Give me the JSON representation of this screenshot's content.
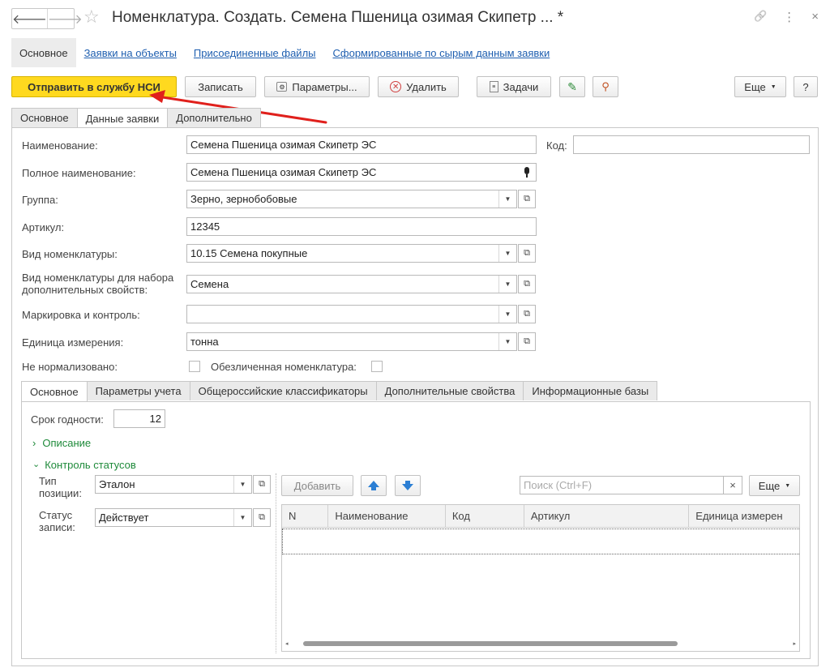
{
  "window": {
    "title": "Номенклатура. Создать. Семена Пшеница озимая Скипетр ... *",
    "back_glyph": "🡐",
    "forward_glyph": "🡒",
    "star_glyph": "☆",
    "link_glyph": "🔗",
    "more_glyph": "⋮",
    "close_glyph": "×"
  },
  "links": {
    "main": "Основное",
    "requests": "Заявки на объекты",
    "files": "Присоединенные файлы",
    "generated": "Сформированные по сырым данным заявки"
  },
  "toolbar": {
    "send": "Отправить в службу НСИ",
    "save": "Записать",
    "params": "Параметры...",
    "delete": "Удалить",
    "tasks": "Задачи",
    "more": "Еще",
    "help": "?"
  },
  "tabs": [
    "Основное",
    "Данные заявки",
    "Дополнительно"
  ],
  "form": {
    "name_label": "Наименование:",
    "name_value": "Семена Пшеница озимая Скипетр ЭС",
    "code_label": "Код:",
    "code_value": "",
    "fullname_label": "Полное наименование:",
    "fullname_value": "Семена Пшеница озимая Скипетр ЭС",
    "group_label": "Группа:",
    "group_value": "Зерно, зернобобовые",
    "article_label": "Артикул:",
    "article_value": "12345",
    "kind_label": "Вид номенклатуры:",
    "kind_value": "10.15 Семена покупные",
    "kind_props_label_1": "Вид номенклатуры для набора",
    "kind_props_label_2": "дополнительных свойств:",
    "kind_props_value": "Семена",
    "marking_label": "Маркировка и контроль:",
    "marking_value": "",
    "unit_label": "Единица измерения:",
    "unit_value": "тонна",
    "not_normalized_label": "Не нормализовано:",
    "not_normalized_checked": false,
    "depersonalized_label": "Обезличенная номенклатура:",
    "depersonalized_checked": false
  },
  "subtabs": [
    "Основное",
    "Параметры учета",
    "Общероссийские классификаторы",
    "Дополнительные свойства",
    "Информационные базы"
  ],
  "sub": {
    "shelf_life_label": "Срок годности:",
    "shelf_life_value": "12",
    "description_label": "Описание",
    "status_control_label": "Контроль статусов",
    "pos_type_label_1": "Тип",
    "pos_type_label_2": "позиции:",
    "pos_type_value": "Эталон",
    "record_status_label_1": "Статус",
    "record_status_label_2": "записи:",
    "record_status_value": "Действует",
    "add_button": "Добавить",
    "search_placeholder": "Поиск (Ctrl+F)",
    "more_button": "Еще",
    "columns": [
      "N",
      "Наименование",
      "Код",
      "Артикул",
      "Единица измерен"
    ]
  },
  "colors": {
    "accent_yellow": "#ffd91f",
    "link_blue": "#1f5fb0",
    "green": "#1e8a3a",
    "arrow_red": "#e0201c"
  }
}
